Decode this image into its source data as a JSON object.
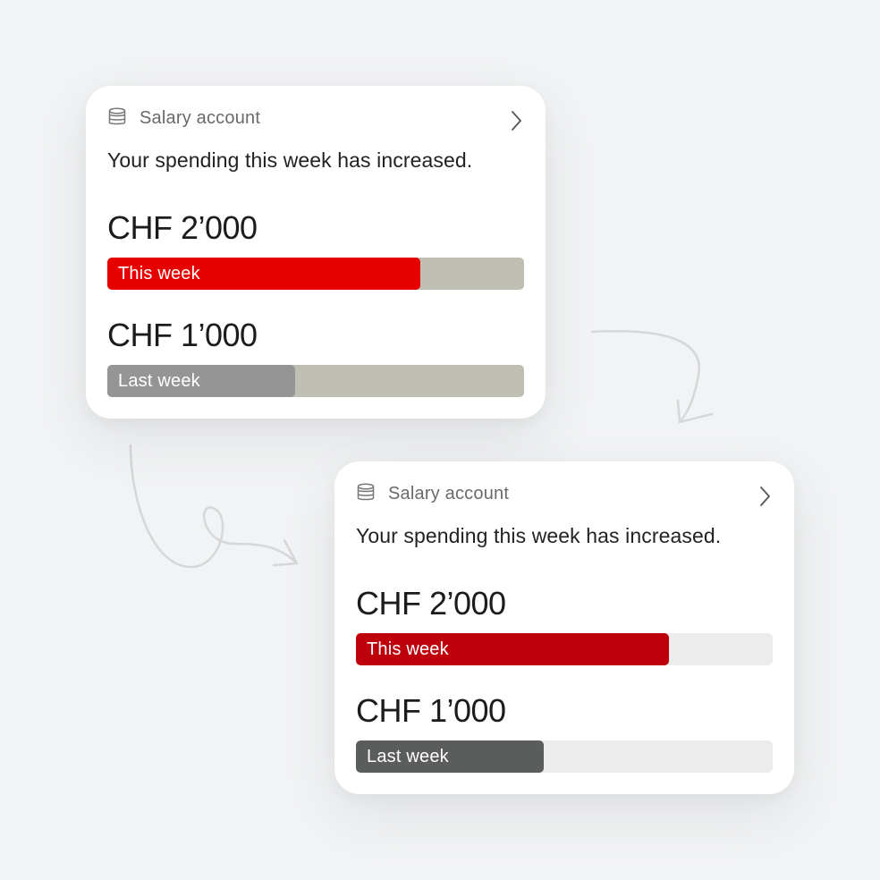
{
  "colors": {
    "background": "#f2f3f4",
    "card_a": {
      "this_week_fill": "#e60000",
      "last_week_fill": "#959595",
      "track": "#bfbfb4"
    },
    "card_b": {
      "this_week_fill": "#bd000c",
      "last_week_fill": "#5a5d5c",
      "track": "#ececec"
    },
    "arrow": "#d8d9da"
  },
  "icons": {
    "account": "database-stack-icon",
    "open": "chevron-right-icon",
    "arrows": "hand-drawn-arrow"
  },
  "cards": [
    {
      "account_name": "Salary account",
      "message": "Your spending this week has increased.",
      "this_week": {
        "amount": "CHF 2’000",
        "label": "This week",
        "fraction": 0.75
      },
      "last_week": {
        "amount": "CHF 1’000",
        "label": "Last week",
        "fraction": 0.45
      }
    },
    {
      "account_name": "Salary account",
      "message": "Your spending this week has increased.",
      "this_week": {
        "amount": "CHF 2’000",
        "label": "This week",
        "fraction": 0.75
      },
      "last_week": {
        "amount": "CHF 1’000",
        "label": "Last week",
        "fraction": 0.45
      }
    }
  ]
}
